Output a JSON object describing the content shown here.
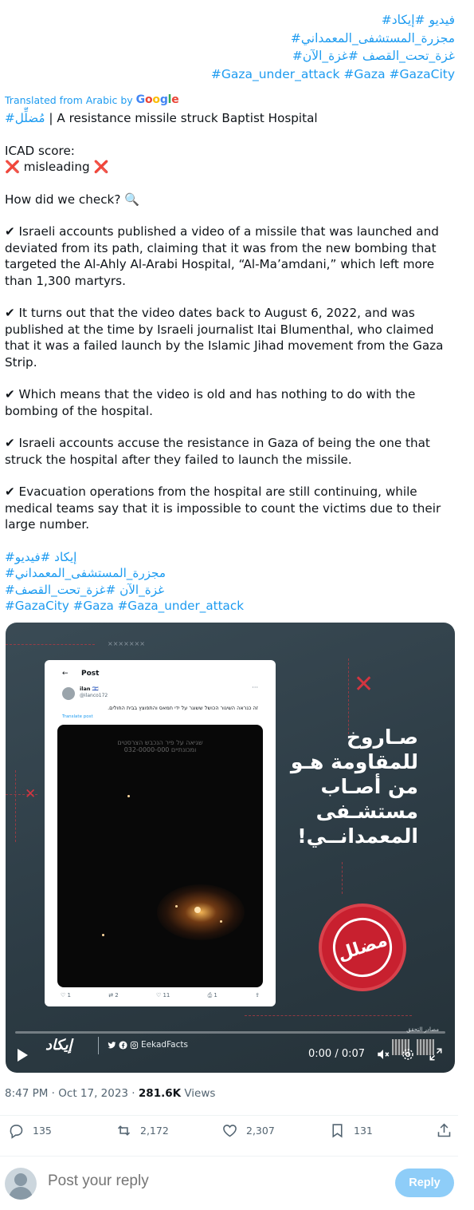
{
  "top_hashtags": {
    "line1": "#فيديو #إيكاد",
    "line2": "#مجزرة_المستشفى_المعمداني",
    "line3": "#غزة_تحت_القصف #غزة_الآن",
    "line4": "#Gaza_under_attack #Gaza #GazaCity"
  },
  "translation": {
    "label": "Translated from Arabic by",
    "provider_letters": [
      "G",
      "o",
      "o",
      "g",
      "l",
      "e"
    ]
  },
  "tweet": {
    "headline_tag": "#مُضلِّل",
    "headline_text": " | A resistance missile struck Baptist Hospital",
    "icad_label": "ICAD score:",
    "score": " misleading ",
    "cross": "❌",
    "check_question": "How did we check? 🔍",
    "check": "✔",
    "points": [
      " Israeli accounts published a video of a missile that was launched and deviated from its path, claiming that it was from the new bombing that targeted the Al-Ahly Al-Arabi Hospital, “Al-Ma’amdani,” which left more than 1,300 martyrs.",
      " It turns out that the video dates back to August 6, 2022, and was published at the time by Israeli journalist Itai Blumenthal, who claimed that it was a failed launch by the Islamic Jihad movement from the Gaza Strip.",
      " Which means that the video is old and has nothing to do with the bombing of the hospital.",
      " Israeli accounts accuse the resistance in Gaza of being the one that struck the hospital after they failed to launch the missile.",
      " Evacuation operations from the hospital are still continuing, while medical teams say that it is impossible to count the victims due to their large number."
    ],
    "bottom_hashtags": {
      "line1": "#إيكاد #فيديو",
      "line2": "#مجزرة_المستشفى_المعمداني",
      "line3": "#غزة_الآن #غزة_تحت_القصف",
      "line4": "#GazaCity #Gaza #Gaza_under_attack"
    }
  },
  "media": {
    "inner_post": {
      "back": "←",
      "title": "Post",
      "user": "ilan 🇮🇱",
      "handle": "@ilanco172",
      "more": "···",
      "text": "זה כנראה השיגור הכושל ששוגר על ידי חמאס והתפוצץ בבית החולים.",
      "translate": "Translate post",
      "video_caption_1": "שגיאה על פיר הנכבש הצרסטים",
      "video_caption_2": "032-0000-000 ומכונתיים",
      "actions": [
        "♡ 1",
        "⇄ 2",
        "♡ 11",
        "⎙ 1",
        "⇪"
      ]
    },
    "headline_lines": [
      "صـاروخ",
      "للمقاومة هـو",
      "من أصـاب",
      "مستشـفى",
      "المعمدانــي!"
    ],
    "seal_text": "مضلل",
    "sources": "مصادر التحقق",
    "brand": "إيكاد",
    "social_handle": "EekadFacts",
    "time": "0:00 / 0:07",
    "red_x": "✕",
    "tiny_label": "×××××××"
  },
  "meta": {
    "time": "8:47 PM · Oct 17, 2023 · ",
    "views_count": "281.6K",
    "views_label": " Views"
  },
  "actions": {
    "replies": "135",
    "reposts": "2,172",
    "likes": "2,307",
    "bookmarks": "131"
  },
  "reply": {
    "placeholder": "Post your reply",
    "button": "Reply"
  }
}
